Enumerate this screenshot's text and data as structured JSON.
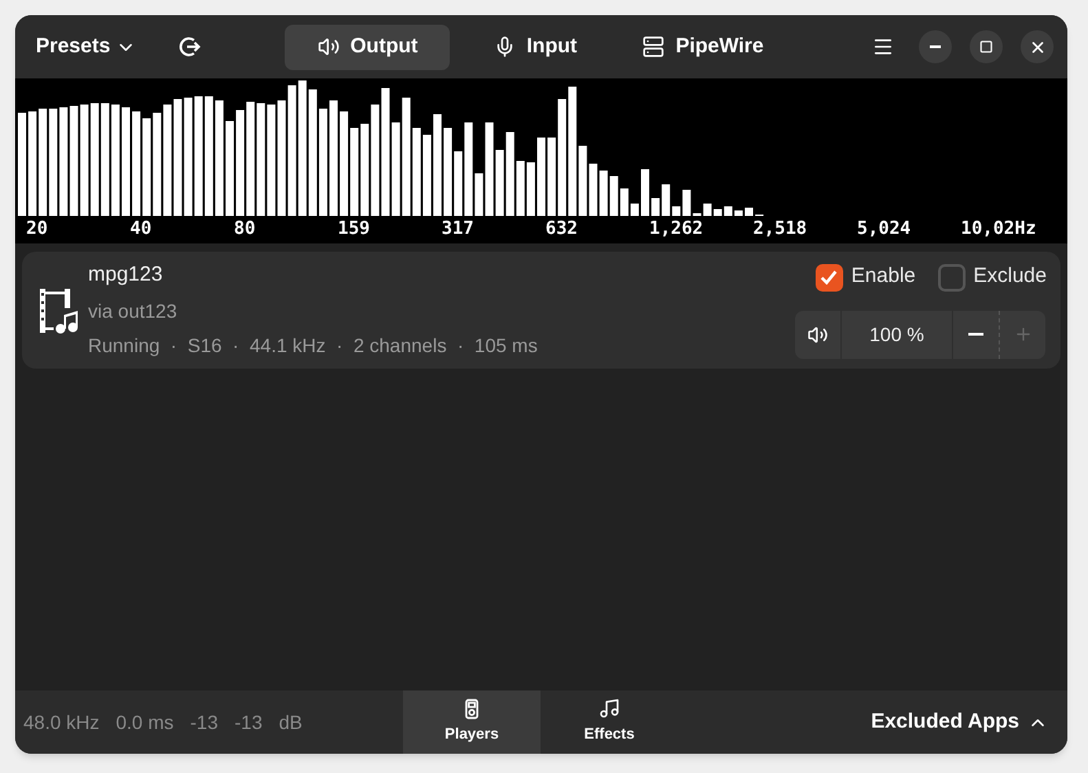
{
  "header": {
    "presets": "Presets",
    "tabs": [
      {
        "label": "Output",
        "kind": "speaker",
        "selected": true
      },
      {
        "label": "Input",
        "kind": "mic",
        "selected": false
      },
      {
        "label": "PipeWire",
        "kind": "server",
        "selected": false
      }
    ]
  },
  "spectrum": {
    "labels": [
      "20",
      "40",
      "80",
      "159",
      "317",
      "632",
      "1,262",
      "2,518",
      "5,024",
      "10,02"
    ],
    "unit": "Hz"
  },
  "apps": [
    {
      "name": "mpg123",
      "subtitle": "via out123",
      "details": "Running  ·  S16  ·  44.1 kHz  ·  2 channels  ·  105 ms",
      "enable": {
        "label": "Enable",
        "checked": true
      },
      "exclude": {
        "label": "Exclude",
        "checked": false
      },
      "volume": "100 %"
    }
  ],
  "status": [
    "48.0 kHz",
    "0.0 ms",
    "-13",
    "-13",
    "dB"
  ],
  "bottom_tabs": [
    {
      "label": "Players",
      "kind": "player",
      "selected": true
    },
    {
      "label": "Effects",
      "kind": "music",
      "selected": false
    }
  ],
  "excluded_apps": "Excluded Apps"
}
